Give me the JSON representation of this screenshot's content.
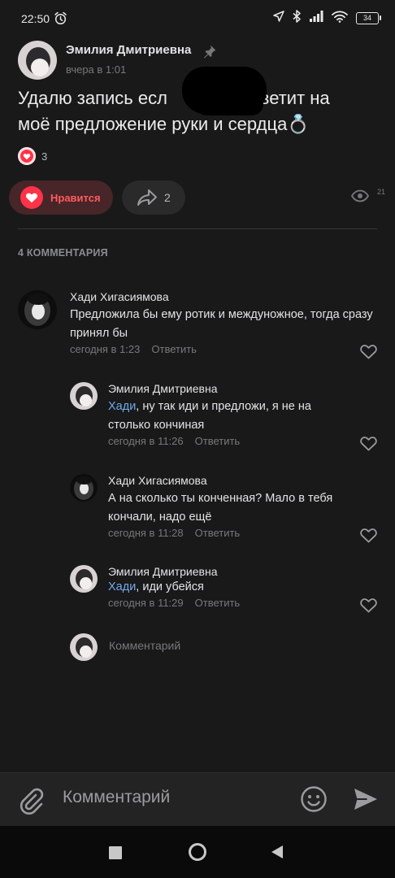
{
  "status_bar": {
    "time": "22:50",
    "battery": "34"
  },
  "post": {
    "author": "Эмилия Дмитриевна",
    "time": "вчера в 1:01",
    "text_line1_a": "Удалю запись есл",
    "text_line1_b": "ответит на",
    "text_line2": "моё предложение руки и сердца💍",
    "likes_count": "3",
    "like_button_label": "Нравится",
    "share_count": "2",
    "views_count": "21"
  },
  "comments_header": "4 КОММЕНТАРИЯ",
  "comments": [
    {
      "author": "Хади Хигасиямова",
      "text": "Предложила бы ему ротик и междуножное, тогда сразу принял бы",
      "time": "сегодня в 1:23",
      "reply_label": "Ответить"
    },
    {
      "author": "Эмилия Дмитриевна",
      "mention": "Хади",
      "text": ", ну так иди и предложи, я не на столько кончиная",
      "time": "сегодня в 11:26",
      "reply_label": "Ответить"
    },
    {
      "author": "Хади Хигасиямова",
      "text": "А на сколько ты конченная? Мало в тебя кончали, надо ещё",
      "time": "сегодня в 11:28",
      "reply_label": "Ответить"
    },
    {
      "author": "Эмилия Дмитриевна",
      "mention": "Хади",
      "text": ", иди убейся",
      "time": "сегодня в 11:29",
      "reply_label": "Ответить"
    }
  ],
  "reply_field": {
    "placeholder": "Комментарий"
  },
  "bottom_bar": {
    "placeholder": "Комментарий"
  },
  "colors": {
    "background": "#19191a",
    "like_accent": "#ff3347",
    "mention": "#71aaeb",
    "secondary_text": "#76787a"
  }
}
